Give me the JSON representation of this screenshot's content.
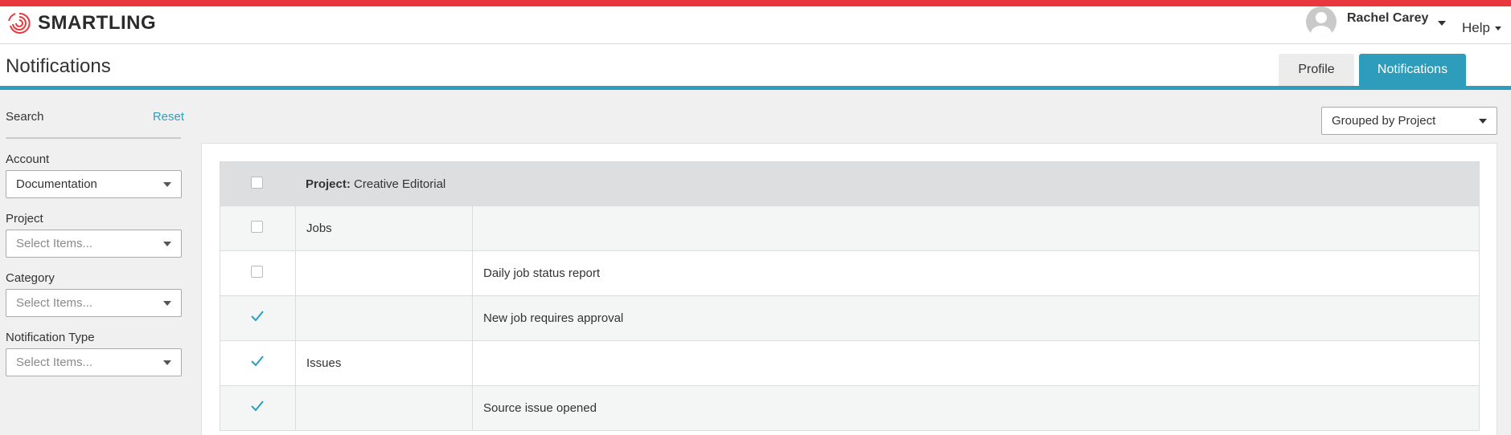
{
  "app": {
    "brand": "SMARTLING",
    "brand_color": "#e8383d",
    "accent_color": "#2e9dbb"
  },
  "user": {
    "name": "Rachel Carey"
  },
  "help_label": "Help",
  "page": {
    "title": "Notifications",
    "tabs": [
      {
        "label": "Profile",
        "active": false
      },
      {
        "label": "Notifications",
        "active": true
      }
    ]
  },
  "sidebar": {
    "search_label": "Search",
    "reset_label": "Reset",
    "filters": [
      {
        "label": "Account",
        "value": "Documentation"
      },
      {
        "label": "Project",
        "placeholder": "Select Items..."
      },
      {
        "label": "Category",
        "placeholder": "Select Items..."
      },
      {
        "label": "Notification Type",
        "placeholder": "Select Items..."
      }
    ]
  },
  "grouping": {
    "value": "Grouped by Project"
  },
  "table": {
    "header": {
      "prefix": "Project:",
      "name": "Creative Editorial",
      "checked": false
    },
    "rows": [
      {
        "category": "Jobs",
        "type": "",
        "checked": false
      },
      {
        "category": "",
        "type": "Daily job status report",
        "checked": false
      },
      {
        "category": "",
        "type": "New job requires approval",
        "checked": true
      },
      {
        "category": "Issues",
        "type": "",
        "checked": true
      },
      {
        "category": "",
        "type": "Source issue opened",
        "checked": true
      }
    ]
  }
}
